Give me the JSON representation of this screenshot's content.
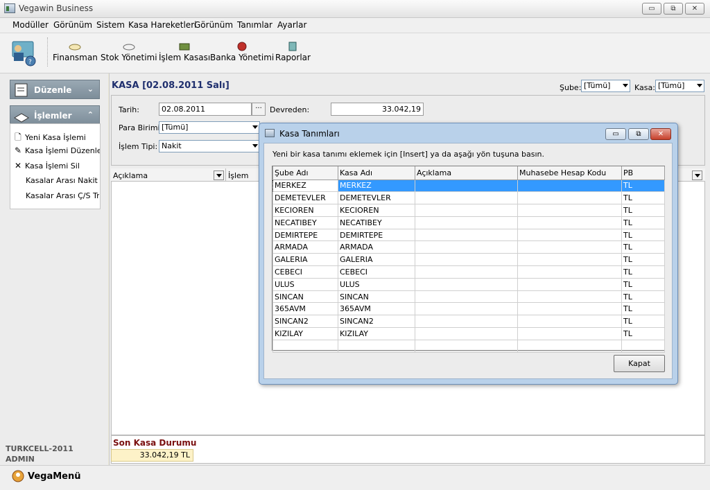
{
  "app": {
    "title": "Vegawin Business"
  },
  "window_buttons": {
    "minimize": "▭",
    "restore": "⧉",
    "close": "✕"
  },
  "menu": [
    "Modüller",
    "Görünüm",
    "Sistem",
    "Kasa Hareketleri",
    "Görünüm",
    "Tanımlar",
    "Ayarlar"
  ],
  "toolbar": {
    "items": [
      {
        "label": "Finansman",
        "icon": "finance-icon"
      },
      {
        "label": "Stok Yönetimi",
        "icon": "stock-icon"
      },
      {
        "label": "İşlem Kasası",
        "icon": "cashbox-icon"
      },
      {
        "label": "Banka Yönetimi",
        "icon": "bank-icon"
      },
      {
        "label": "Raporlar",
        "icon": "reports-icon"
      }
    ]
  },
  "sidebar": {
    "duzenle_header": "Düzenle",
    "islemler_header": "İşlemler",
    "items": [
      {
        "label": "Yeni Kasa İşlemi",
        "icon": "new-doc-icon"
      },
      {
        "label": "Kasa İşlemi Düzenle",
        "icon": "edit-icon"
      },
      {
        "label": "Kasa İşlemi Sil",
        "icon": "delete-icon"
      },
      {
        "label": "Kasalar Arası Nakit T...",
        "icon": ""
      },
      {
        "label": "Kasalar Arası Ç/S Tr...",
        "icon": ""
      }
    ],
    "company": "TURKCELL-2011",
    "user": "ADMIN"
  },
  "main": {
    "title": "KASA [02.08.2011 Salı]",
    "sube_label": "Şube:",
    "sube_value": "[Tümü]",
    "kasa_label": "Kasa:",
    "kasa_value": "[Tümü]",
    "tarih_label": "Tarih:",
    "tarih_value": "02.08.2011",
    "devreden_label": "Devreden:",
    "devreden_value": "33.042,19",
    "para_birimi_label": "Para Birimi:",
    "para_birimi_value": "[Tümü]",
    "islem_tipi_label": "İşlem Tipi:",
    "islem_tipi_value": "Nakit",
    "grid_columns": [
      "Açıklama",
      "İşlem"
    ],
    "son_kasa_title": "Son Kasa Durumu",
    "son_kasa_value": "33.042,19 TL"
  },
  "dialog": {
    "title": "Kasa Tanımları",
    "hint": "Yeni bir kasa tanımı eklemek için [Insert] ya da aşağı yön tuşuna basın.",
    "columns": [
      "Şube Adı",
      "Kasa Adı",
      "Açıklama",
      "Muhasebe Hesap Kodu",
      "PB"
    ],
    "rows": [
      [
        "MERKEZ",
        "MERKEZ",
        "",
        "",
        "TL"
      ],
      [
        "DEMETEVLER",
        "DEMETEVLER",
        "",
        "",
        "TL"
      ],
      [
        "KECIOREN",
        "KECIOREN",
        "",
        "",
        "TL"
      ],
      [
        "NECATIBEY",
        "NECATIBEY",
        "",
        "",
        "TL"
      ],
      [
        "DEMIRTEPE",
        "DEMIRTEPE",
        "",
        "",
        "TL"
      ],
      [
        "ARMADA",
        "ARMADA",
        "",
        "",
        "TL"
      ],
      [
        "GALERIA",
        "GALERIA",
        "",
        "",
        "TL"
      ],
      [
        "CEBECI",
        "CEBECI",
        "",
        "",
        "TL"
      ],
      [
        "ULUS",
        "ULUS",
        "",
        "",
        "TL"
      ],
      [
        "SINCAN",
        "SINCAN",
        "",
        "",
        "TL"
      ],
      [
        "365AVM",
        "365AVM",
        "",
        "",
        "TL"
      ],
      [
        "SINCAN2",
        "SINCAN2",
        "",
        "",
        "TL"
      ],
      [
        "KIZILAY",
        "KIZILAY",
        "",
        "",
        "TL"
      ]
    ],
    "close_button": "Kapat"
  },
  "statusbar": {
    "label": "VegaMenü"
  },
  "colors": {
    "selection": "#3399ff",
    "title_blue": "#1f2f6e",
    "son_kasa_red": "#7a1010"
  }
}
